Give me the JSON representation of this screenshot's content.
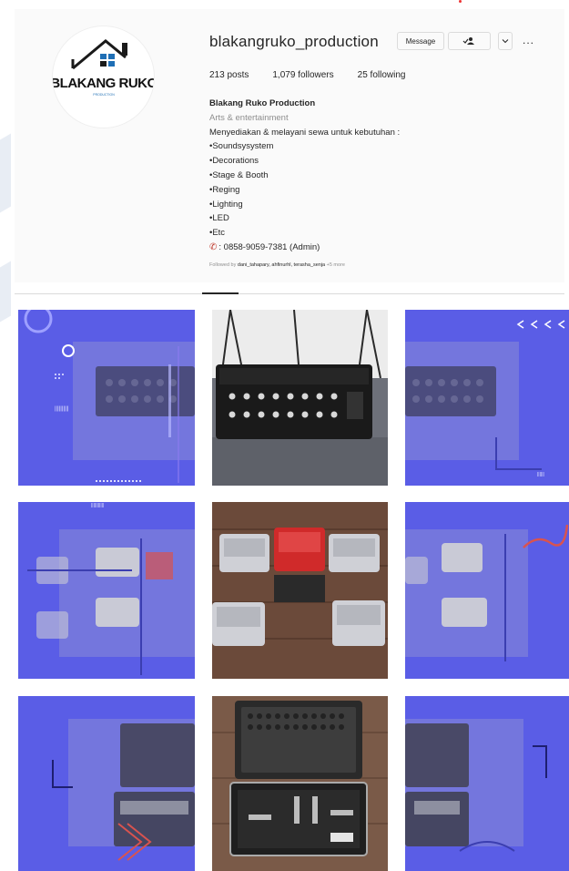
{
  "profile": {
    "username": "blakangruko_production",
    "avatar_logo_text": "BLAKANG RUKO",
    "avatar_logo_sub": "PRODUCTION",
    "message_label": "Message",
    "follow_icon": "person-check-icon",
    "chevron_icon": "chevron-down-icon",
    "more_label": "...",
    "stats": {
      "posts": "213 posts",
      "followers": "1,079 followers",
      "following": "25 following"
    },
    "bio": {
      "name": "Blakang Ruko Production",
      "category": "Arts & entertainment",
      "lines": [
        "Menyediakan & melayani sewa untuk kebutuhan :",
        "•Soundsysystem",
        "•Decorations",
        "•Stage & Booth",
        "•Reging",
        "•Lighting",
        "•LED",
        "•Etc"
      ],
      "phone_icon": "phone-icon",
      "phone": ": 0858-9059-7381 (Admin)"
    },
    "followed_by_prefix": "Followed by ",
    "followed_by_names": "dani_tahapary, ahfinurhl, terasha_senja",
    "followed_by_suffix": " +5 more"
  },
  "posts": [
    {
      "subject": "digital mixer",
      "style": "promo"
    },
    {
      "subject": "digital mixer",
      "style": "photo"
    },
    {
      "subject": "digital mixer",
      "style": "promo"
    },
    {
      "subject": "power amplifiers",
      "style": "promo"
    },
    {
      "subject": "power amplifiers",
      "style": "photo"
    },
    {
      "subject": "power amplifiers",
      "style": "promo"
    },
    {
      "subject": "microphone case",
      "style": "promo"
    },
    {
      "subject": "microphone case",
      "style": "photo"
    },
    {
      "subject": "microphone case",
      "style": "promo"
    }
  ],
  "colors": {
    "promo_bg": "#5a5de6",
    "accent_red": "#c0392b"
  }
}
